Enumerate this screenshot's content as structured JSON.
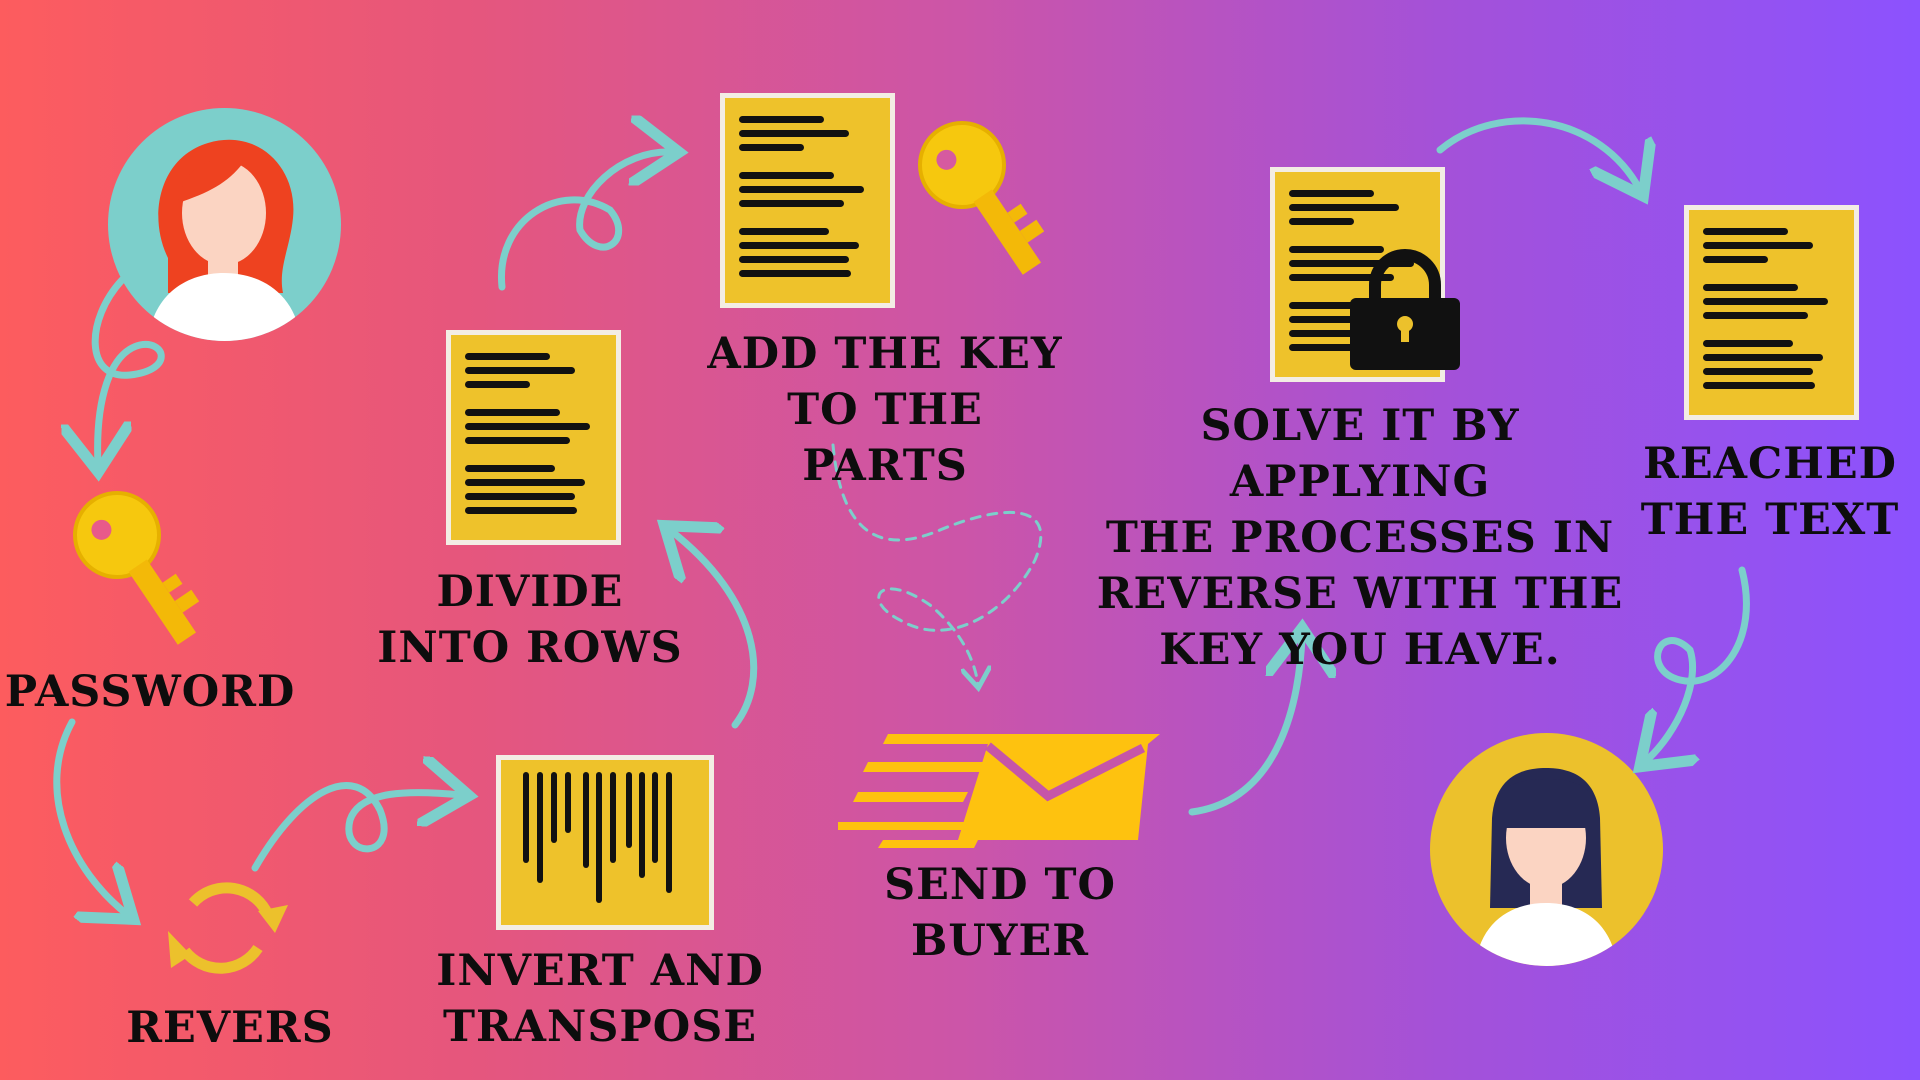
{
  "diagram": {
    "steps": [
      {
        "id": "password",
        "label": "PASSWORD"
      },
      {
        "id": "revers",
        "label": "REVERS"
      },
      {
        "id": "invert",
        "label": "INVERT AND\nTRANSPOSE"
      },
      {
        "id": "divide",
        "label": "DIVIDE\nINTO ROWS"
      },
      {
        "id": "add-key",
        "label": "ADD THE KEY\nTO THE PARTS"
      },
      {
        "id": "send",
        "label": "SEND TO BUYER"
      },
      {
        "id": "solve",
        "label": "SOLVE IT BY APPLYING\nTHE PROCESSES IN\nREVERSE WITH THE\nKEY YOU HAVE."
      },
      {
        "id": "reached",
        "label": "REACHED\nTHE TEXT"
      }
    ]
  },
  "icons": [
    "sender-avatar-icon",
    "key-icon",
    "refresh-icon",
    "document-icon",
    "barcode-document-icon",
    "envelope-icon",
    "lock-icon",
    "receiver-avatar-icon"
  ],
  "colors": {
    "gradient_left": "#fd5c5e",
    "gradient_right": "#8c52fe",
    "arrow": "#7ccfcb",
    "document": "#eec22b",
    "key": "#f5c20c",
    "envelope": "#fec20f",
    "text": "#0d0d0d"
  }
}
